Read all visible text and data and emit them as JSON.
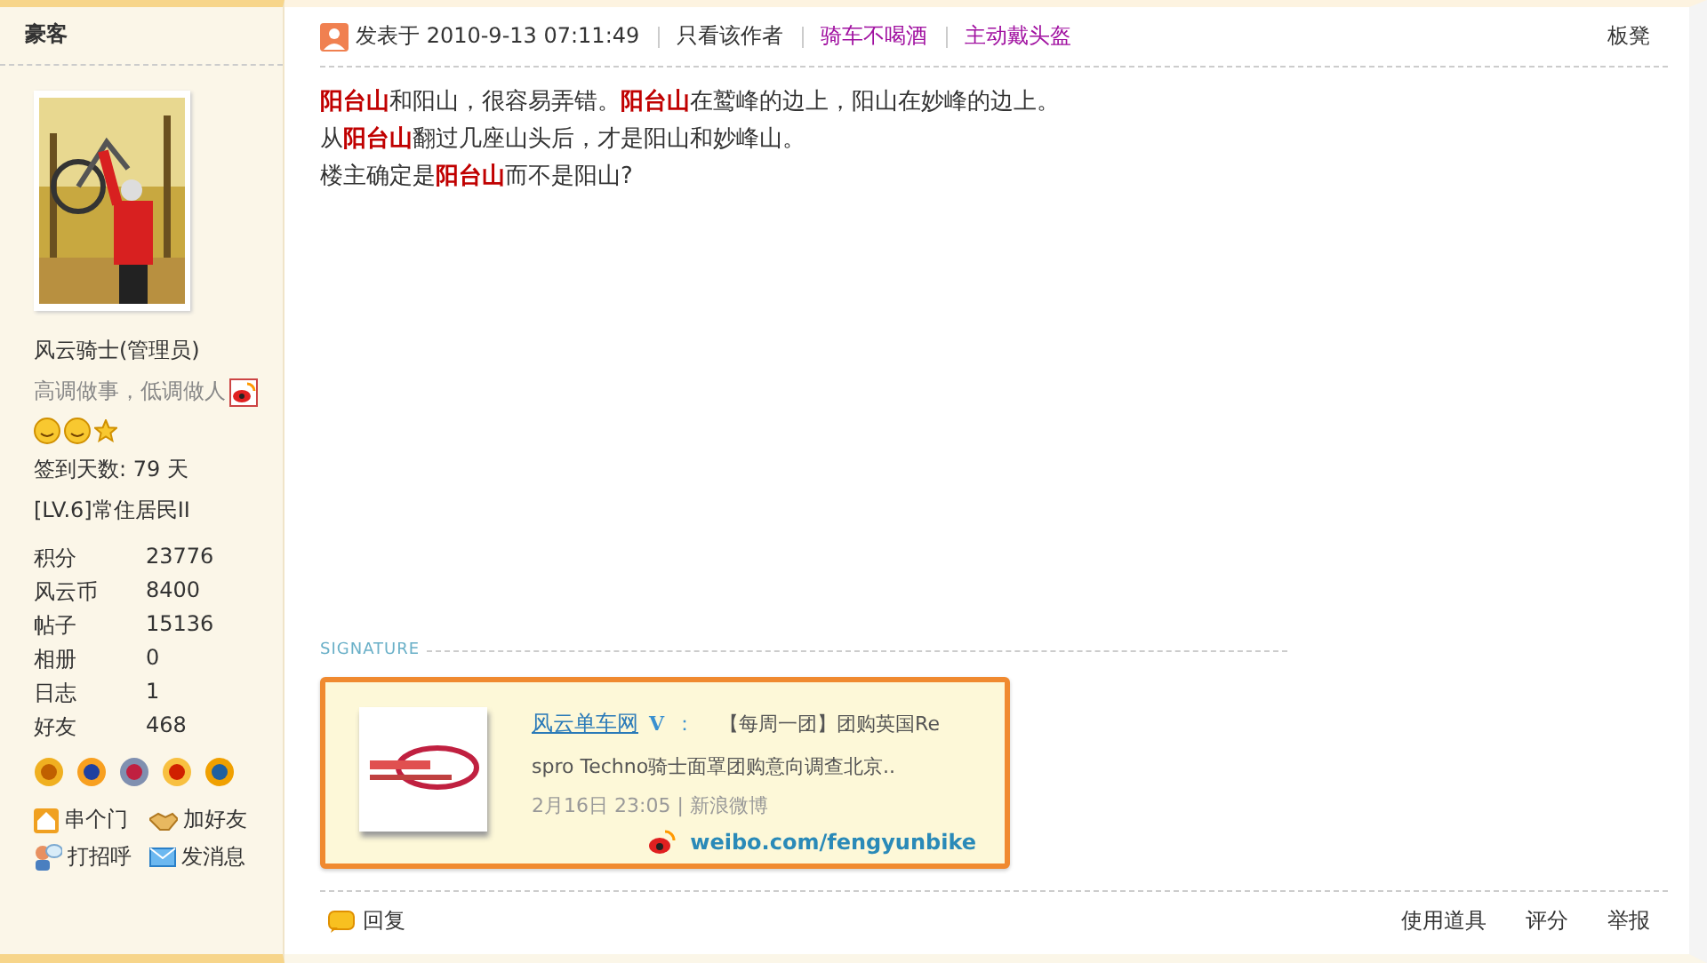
{
  "sidebar": {
    "username_header": "豪客",
    "nickname": "风云骑士(管理员)",
    "motto": "高调做事，低调做人",
    "checkin": "签到天数: 79 天",
    "level": "[LV.6]常住居民II",
    "stats": [
      {
        "label": "积分",
        "value": "23776"
      },
      {
        "label": "风云币",
        "value": "8400"
      },
      {
        "label": "帖子",
        "value": "15136"
      },
      {
        "label": "相册",
        "value": "0"
      },
      {
        "label": "日志",
        "value": "1"
      },
      {
        "label": "好友",
        "value": "468"
      }
    ],
    "actions": [
      {
        "kind": "home",
        "label": "串个门"
      },
      {
        "kind": "friend",
        "label": "加好友"
      },
      {
        "kind": "greet",
        "label": "打招呼"
      },
      {
        "kind": "mail",
        "label": "发消息"
      }
    ]
  },
  "post": {
    "posted": "发表于 2010-9-13 07:11:49",
    "author_only": "只看该作者",
    "tags": [
      "骑车不喝酒",
      "主动戴头盔"
    ],
    "floor": "板凳",
    "body": [
      "**阳台山**和阳山，很容易弄错。**阳台山**在鹫峰的边上，阳山在妙峰的边上。",
      "从**阳台山**翻过几座山头后，才是阳山和妙峰山。",
      "楼主确定是**阳台山**而不是阳山?"
    ],
    "signature": {
      "label": "SIGNATURE",
      "weibo_name": "风云单车网",
      "verified": "V",
      "colon": "：",
      "weibo_text": [
        "【每周一团】团购英国Re",
        "spro Techno骑士面罩团购意向调查北京.."
      ],
      "time": "2月16日 23:05 | 新浪微博",
      "link": "weibo.com/fengyunbike"
    },
    "reply": "回复",
    "footer_links": [
      "使用道具",
      "评分",
      "举报"
    ]
  }
}
